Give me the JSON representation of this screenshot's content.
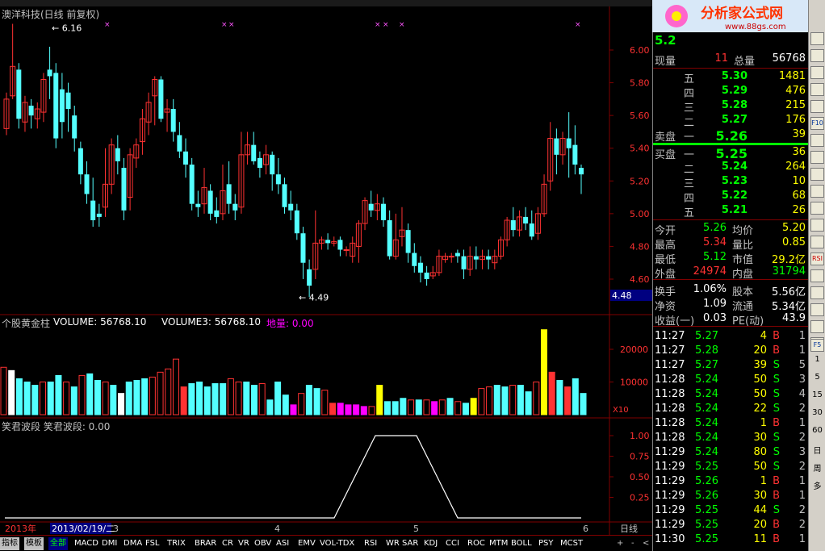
{
  "title": "澳洋科技(日线 前复权)",
  "price_axis": [
    "6.00",
    "5.80",
    "5.60",
    "5.40",
    "5.20",
    "5.00",
    "4.80",
    "4.60"
  ],
  "cur_price_tag": "4.48",
  "hi_label": "6.16",
  "lo_label": "4.49",
  "vol_header": {
    "name": "个股黄金柱",
    "v1": "VOLUME: 56768.10",
    "v3": "VOLUME3: 56768.10",
    "dl": "地量: 0.00"
  },
  "vol_axis": [
    "20000",
    "10000"
  ],
  "vol_unit": "X10",
  "wave_header": "笑君波段 笑君波段: 0.00",
  "wave_axis": [
    "1.00",
    "0.75",
    "0.50",
    "0.25"
  ],
  "x_labels": {
    "year": "2013年",
    "date": "2013/02/19/二",
    "m3": "3",
    "m4": "4",
    "m5": "5",
    "m6": "6"
  },
  "period": "日线",
  "tabs": [
    "指标",
    "模板",
    "全部",
    "MACD",
    "DMI",
    "DMA",
    "FSL",
    "TRIX",
    "BRAR",
    "CR",
    "VR",
    "OBV",
    "ASI",
    "EMV",
    "VOL-TDX",
    "RSI",
    "WR",
    "SAR",
    "KDJ",
    "CCI",
    "ROC",
    "MTM",
    "BOLL",
    "PSY",
    "MCST"
  ],
  "logo": {
    "text": "分析家公式网",
    "url": "www.88gs.com"
  },
  "quote": {
    "price_partial": "5.2",
    "xianliang_label": "现量",
    "xianliang": "11",
    "zongliang_label": "总量",
    "zongliang": "56768",
    "sell": [
      {
        "lvl": "五",
        "p": "5.30",
        "v": "1481"
      },
      {
        "lvl": "四",
        "p": "5.29",
        "v": "476"
      },
      {
        "lvl": "三",
        "p": "5.28",
        "v": "215"
      },
      {
        "lvl": "二",
        "p": "5.27",
        "v": "176"
      },
      {
        "lvl": "一",
        "p": "5.26",
        "v": "39"
      }
    ],
    "sell_label": "卖盘",
    "buy_label": "买盘",
    "buy": [
      {
        "lvl": "一",
        "p": "5.25",
        "v": "36"
      },
      {
        "lvl": "二",
        "p": "5.24",
        "v": "264"
      },
      {
        "lvl": "三",
        "p": "5.23",
        "v": "10"
      },
      {
        "lvl": "四",
        "p": "5.22",
        "v": "68"
      },
      {
        "lvl": "五",
        "p": "5.21",
        "v": "26"
      }
    ],
    "stats": [
      {
        "l1": "今开",
        "v1": "5.26",
        "l2": "均价",
        "v2": "5.20"
      },
      {
        "l1": "最高",
        "v1": "5.34",
        "l2": "量比",
        "v2": "0.85"
      },
      {
        "l1": "最低",
        "v1": "5.12",
        "l2": "市值",
        "v2": "29.2亿"
      },
      {
        "l1": "外盘",
        "v1": "24974",
        "l2": "内盘",
        "v2": "31794"
      },
      {
        "l1": "换手",
        "v1": "1.06%",
        "l2": "股本",
        "v2": "5.56亿"
      },
      {
        "l1": "净资",
        "v1": "1.09",
        "l2": "流通",
        "v2": "5.34亿"
      },
      {
        "l1": "收益(一)",
        "v1": "0.03",
        "l2": "PE(动)",
        "v2": "43.9"
      }
    ],
    "ticks": [
      {
        "t": "11:27",
        "p": "5.27",
        "v": "4",
        "s": "B",
        "n": "1"
      },
      {
        "t": "11:27",
        "p": "5.28",
        "v": "20",
        "s": "B",
        "n": "1"
      },
      {
        "t": "11:27",
        "p": "5.27",
        "v": "39",
        "s": "S",
        "n": "5"
      },
      {
        "t": "11:28",
        "p": "5.24",
        "v": "50",
        "s": "S",
        "n": "3"
      },
      {
        "t": "11:28",
        "p": "5.24",
        "v": "50",
        "s": "S",
        "n": "4"
      },
      {
        "t": "11:28",
        "p": "5.24",
        "v": "22",
        "s": "S",
        "n": "2"
      },
      {
        "t": "11:28",
        "p": "5.24",
        "v": "1",
        "s": "B",
        "n": "1"
      },
      {
        "t": "11:28",
        "p": "5.24",
        "v": "30",
        "s": "S",
        "n": "2"
      },
      {
        "t": "11:29",
        "p": "5.24",
        "v": "80",
        "s": "S",
        "n": "3"
      },
      {
        "t": "11:29",
        "p": "5.25",
        "v": "50",
        "s": "S",
        "n": "2"
      },
      {
        "t": "11:29",
        "p": "5.26",
        "v": "1",
        "s": "B",
        "n": "1"
      },
      {
        "t": "11:29",
        "p": "5.26",
        "v": "30",
        "s": "B",
        "n": "1"
      },
      {
        "t": "11:29",
        "p": "5.25",
        "v": "44",
        "s": "S",
        "n": "2"
      },
      {
        "t": "11:29",
        "p": "5.25",
        "v": "20",
        "s": "B",
        "n": "2"
      },
      {
        "t": "11:30",
        "p": "5.25",
        "v": "11",
        "s": "B",
        "n": "1"
      }
    ]
  },
  "toolbar_nums": [
    "1",
    "5",
    "15",
    "30",
    "60",
    "日",
    "周",
    "多"
  ],
  "toolbar_btns": [
    "F10",
    "RSI",
    "F5"
  ],
  "colors": {
    "up": "#ff3232",
    "down": "#54ffff",
    "grid": "#800000",
    "yellow": "#ffff00"
  },
  "chart_data": {
    "type": "candlestick",
    "ylim": [
      4.4,
      6.25
    ],
    "candles": [
      [
        5.52,
        5.7,
        5.48,
        5.74
      ],
      [
        5.72,
        5.9,
        5.7,
        6.16
      ],
      [
        5.88,
        5.58,
        5.52,
        5.92
      ],
      [
        5.56,
        5.68,
        5.5,
        5.72
      ],
      [
        5.66,
        5.6,
        5.52,
        5.7
      ],
      [
        5.58,
        5.64,
        5.52,
        5.68
      ],
      [
        5.62,
        5.82,
        5.56,
        5.86
      ],
      [
        5.88,
        5.84,
        5.7,
        6.02
      ],
      [
        5.86,
        5.46,
        5.4,
        5.92
      ],
      [
        5.76,
        5.56,
        5.46,
        5.86
      ],
      [
        5.74,
        5.64,
        5.5,
        5.8
      ],
      [
        5.6,
        5.46,
        5.38,
        5.66
      ],
      [
        5.4,
        5.24,
        5.18,
        5.44
      ],
      [
        5.24,
        5.12,
        5.06,
        5.32
      ],
      [
        5.08,
        4.96,
        4.92,
        5.22
      ],
      [
        5.0,
        4.98,
        4.92,
        5.06
      ],
      [
        5.04,
        5.18,
        4.98,
        5.4
      ],
      [
        5.18,
        5.42,
        5.12,
        5.46
      ],
      [
        5.4,
        5.32,
        5.24,
        5.48
      ],
      [
        5.28,
        5.02,
        4.96,
        5.34
      ],
      [
        5.1,
        5.36,
        5.02,
        5.4
      ],
      [
        5.34,
        5.42,
        5.28,
        5.46
      ],
      [
        5.44,
        5.58,
        5.36,
        5.64
      ],
      [
        5.56,
        5.68,
        5.48,
        5.74
      ],
      [
        5.72,
        5.82,
        5.54,
        5.84
      ],
      [
        5.82,
        5.58,
        5.56,
        5.84
      ],
      [
        5.62,
        5.64,
        5.5,
        5.7
      ],
      [
        5.64,
        5.5,
        5.44,
        5.7
      ],
      [
        5.48,
        5.38,
        5.34,
        5.56
      ],
      [
        5.38,
        5.3,
        5.22,
        5.46
      ],
      [
        5.3,
        5.06,
        5.02,
        5.34
      ],
      [
        5.06,
        5.04,
        4.98,
        5.14
      ],
      [
        5.06,
        5.16,
        5.0,
        5.28
      ],
      [
        5.14,
        5.0,
        4.96,
        5.18
      ],
      [
        5.02,
        4.98,
        4.94,
        5.1
      ],
      [
        5.0,
        5.14,
        4.96,
        5.3
      ],
      [
        5.18,
        5.06,
        5.0,
        5.32
      ],
      [
        5.06,
        5.02,
        4.96,
        5.12
      ],
      [
        5.04,
        5.36,
        5.0,
        5.5
      ],
      [
        5.36,
        5.42,
        5.3,
        5.5
      ],
      [
        5.42,
        5.32,
        5.3,
        5.5
      ],
      [
        5.34,
        5.28,
        5.22,
        5.38
      ],
      [
        5.3,
        5.36,
        5.24,
        5.42
      ],
      [
        5.36,
        5.24,
        5.14,
        5.38
      ],
      [
        5.24,
        5.18,
        5.12,
        5.34
      ],
      [
        5.18,
        5.04,
        5.0,
        5.22
      ],
      [
        5.06,
        5.02,
        4.96,
        5.14
      ],
      [
        5.02,
        4.88,
        4.84,
        5.06
      ],
      [
        4.88,
        4.7,
        4.6,
        4.92
      ],
      [
        4.66,
        4.56,
        4.49,
        4.72
      ],
      [
        4.66,
        4.82,
        4.6,
        5.02
      ],
      [
        4.82,
        4.84,
        4.78,
        4.86
      ],
      [
        4.84,
        4.82,
        4.78,
        4.88
      ],
      [
        4.82,
        4.83,
        4.8,
        4.86
      ],
      [
        4.84,
        4.78,
        4.74,
        4.86
      ],
      [
        4.78,
        4.78,
        4.74,
        4.8
      ],
      [
        4.74,
        4.82,
        4.7,
        4.86
      ],
      [
        4.8,
        4.94,
        4.7,
        4.96
      ],
      [
        4.94,
        5.08,
        4.9,
        5.1
      ],
      [
        5.06,
        5.02,
        4.98,
        5.14
      ],
      [
        5.02,
        5.06,
        4.96,
        5.12
      ],
      [
        5.06,
        4.96,
        4.92,
        5.1
      ],
      [
        4.96,
        4.74,
        4.72,
        5.02
      ],
      [
        4.74,
        4.84,
        4.72,
        5.0
      ],
      [
        4.86,
        4.9,
        4.8,
        5.04
      ],
      [
        4.9,
        4.76,
        4.7,
        4.94
      ],
      [
        4.76,
        4.68,
        4.64,
        4.82
      ],
      [
        4.7,
        4.64,
        4.58,
        4.74
      ],
      [
        4.64,
        4.6,
        4.56,
        4.68
      ],
      [
        4.62,
        4.64,
        4.6,
        4.68
      ],
      [
        4.64,
        4.74,
        4.62,
        4.78
      ],
      [
        4.72,
        4.74,
        4.7,
        4.76
      ],
      [
        4.74,
        4.74,
        4.7,
        4.76
      ],
      [
        4.76,
        4.74,
        4.7,
        4.78
      ],
      [
        4.74,
        4.66,
        4.6,
        4.78
      ],
      [
        4.66,
        4.74,
        4.62,
        4.8
      ],
      [
        4.74,
        4.72,
        4.66,
        4.8
      ],
      [
        4.72,
        4.74,
        4.66,
        4.78
      ],
      [
        4.74,
        4.72,
        4.66,
        4.78
      ],
      [
        4.7,
        4.74,
        4.66,
        4.78
      ],
      [
        4.74,
        4.84,
        4.72,
        4.86
      ],
      [
        4.84,
        4.96,
        4.8,
        4.98
      ],
      [
        4.96,
        4.9,
        4.86,
        5.04
      ],
      [
        4.9,
        4.98,
        4.86,
        5.02
      ],
      [
        4.98,
        4.94,
        4.9,
        5.04
      ],
      [
        4.94,
        4.86,
        4.84,
        5.02
      ],
      [
        4.88,
        5.0,
        4.84,
        5.04
      ],
      [
        5.0,
        5.18,
        4.98,
        5.24
      ],
      [
        5.2,
        5.46,
        5.14,
        5.56
      ],
      [
        5.46,
        5.36,
        5.24,
        5.52
      ],
      [
        5.36,
        5.46,
        5.3,
        5.5
      ],
      [
        5.46,
        5.4,
        5.22,
        5.62
      ],
      [
        5.42,
        5.3,
        5.24,
        5.54
      ],
      [
        5.28,
        5.24,
        5.12,
        5.3
      ]
    ],
    "volume": [
      [
        1450,
        "u"
      ],
      [
        1350,
        "w"
      ],
      [
        1100,
        "d"
      ],
      [
        1000,
        "d"
      ],
      [
        900,
        "d"
      ],
      [
        1000,
        "u"
      ],
      [
        1000,
        "d"
      ],
      [
        1200,
        "d"
      ],
      [
        1000,
        "u"
      ],
      [
        850,
        "d"
      ],
      [
        1200,
        "u"
      ],
      [
        1250,
        "d"
      ],
      [
        1050,
        "d"
      ],
      [
        1000,
        "u"
      ],
      [
        900,
        "d"
      ],
      [
        650,
        "w"
      ],
      [
        1000,
        "d"
      ],
      [
        1050,
        "d"
      ],
      [
        1100,
        "d"
      ],
      [
        1150,
        "u"
      ],
      [
        1300,
        "u"
      ],
      [
        1400,
        "u"
      ],
      [
        1700,
        "u"
      ],
      [
        850,
        "r"
      ],
      [
        950,
        "d"
      ],
      [
        1000,
        "d"
      ],
      [
        850,
        "d"
      ],
      [
        950,
        "d"
      ],
      [
        950,
        "d"
      ],
      [
        1100,
        "u"
      ],
      [
        1000,
        "u"
      ],
      [
        1000,
        "d"
      ],
      [
        900,
        "d"
      ],
      [
        950,
        "u"
      ],
      [
        450,
        "d"
      ],
      [
        1000,
        "d"
      ],
      [
        600,
        "d"
      ],
      [
        300,
        "m"
      ],
      [
        650,
        "u"
      ],
      [
        900,
        "d"
      ],
      [
        800,
        "d"
      ],
      [
        750,
        "u"
      ],
      [
        350,
        "r"
      ],
      [
        350,
        "m"
      ],
      [
        300,
        "m"
      ],
      [
        300,
        "m"
      ],
      [
        250,
        "m"
      ],
      [
        250,
        "u"
      ],
      [
        900,
        "y"
      ],
      [
        400,
        "d"
      ],
      [
        400,
        "d"
      ],
      [
        500,
        "d"
      ],
      [
        450,
        "u"
      ],
      [
        450,
        "d"
      ],
      [
        450,
        "u"
      ],
      [
        400,
        "m"
      ],
      [
        450,
        "u"
      ],
      [
        500,
        "d"
      ],
      [
        400,
        "u"
      ],
      [
        350,
        "d"
      ],
      [
        500,
        "y"
      ],
      [
        800,
        "u"
      ],
      [
        850,
        "u"
      ],
      [
        900,
        "d"
      ],
      [
        850,
        "d"
      ],
      [
        900,
        "u"
      ],
      [
        900,
        "d"
      ],
      [
        700,
        "d"
      ],
      [
        1000,
        "u"
      ],
      [
        2600,
        "y"
      ],
      [
        1300,
        "r"
      ],
      [
        1050,
        "d"
      ],
      [
        850,
        "r"
      ],
      [
        1100,
        "d"
      ],
      [
        650,
        "d"
      ]
    ],
    "wave": [
      0,
      0,
      0,
      0,
      0,
      0,
      0,
      0,
      0,
      1,
      1,
      0,
      0,
      0,
      0
    ]
  }
}
